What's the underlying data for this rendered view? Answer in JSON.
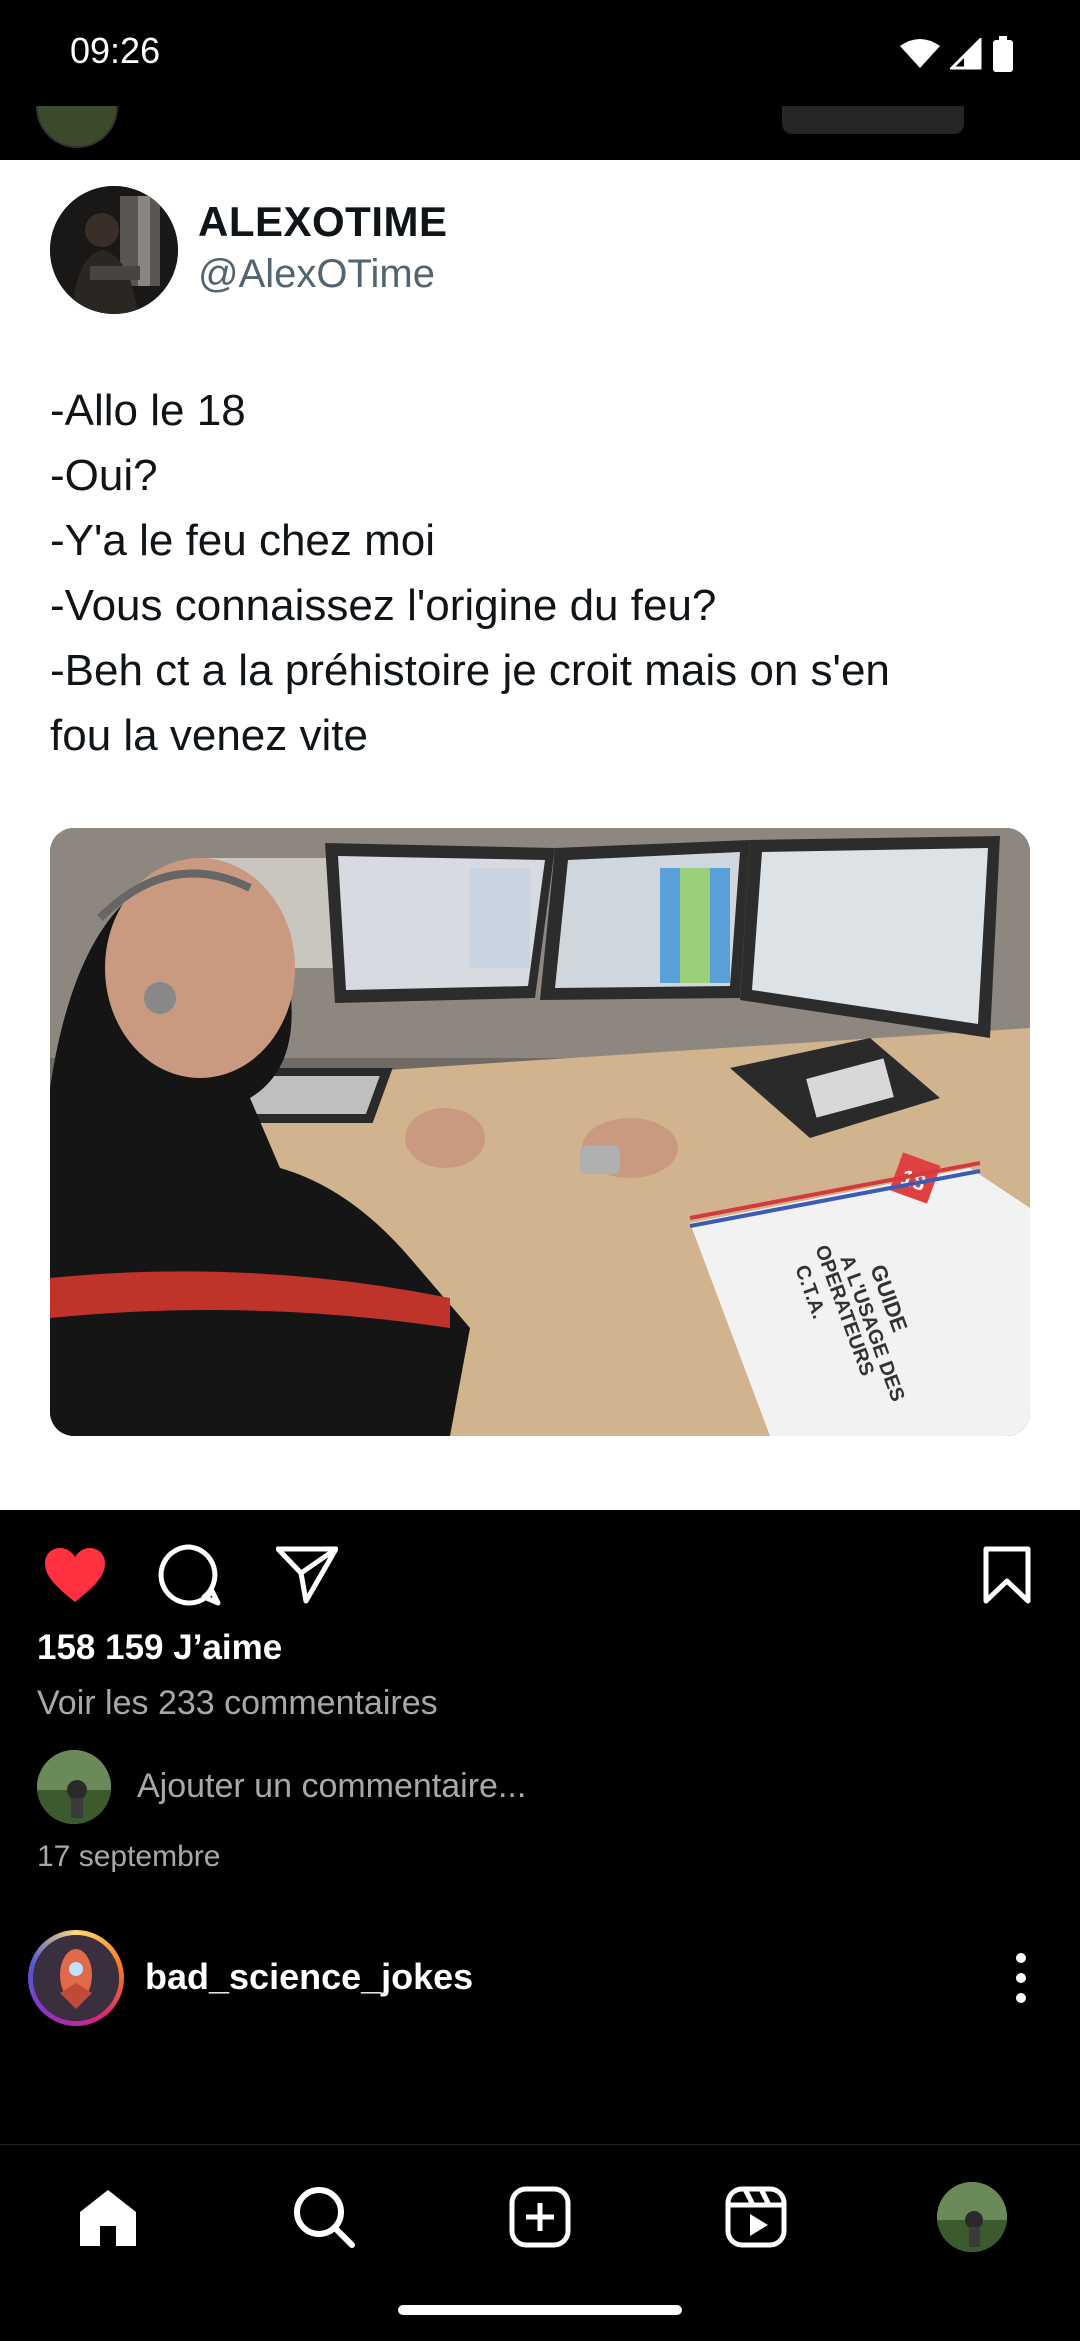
{
  "status_bar": {
    "time": "09:26"
  },
  "tweet": {
    "display_name": "ALEXOTIME",
    "handle": "@AlexOTime",
    "lines": [
      "-Allo le 18",
      "-Oui?",
      "-Y'a le feu chez moi",
      "-Vous connaissez l'origine du feu?",
      "-Beh ct a la préhistoire je croit mais on s'en",
      "fou la venez vite"
    ],
    "photo_binder_text": [
      "GUIDE",
      "A L'USAGE DES",
      "OPERATEURS",
      "C.T.A."
    ],
    "photo_binder_badge": "18"
  },
  "post": {
    "likes_text": "158 159 J’aime",
    "comments_text": "Voir les 233 commentaires",
    "add_comment_placeholder": "Ajouter un commentaire...",
    "date": "17 septembre",
    "liked": true,
    "like_color": "#ff3040"
  },
  "next_post": {
    "username": "bad_science_jokes"
  },
  "icons": {
    "like": "heart-icon",
    "comment": "comment-bubble-icon",
    "share": "paper-plane-icon",
    "save": "bookmark-icon",
    "more": "more-vertical-icon",
    "nav": [
      "home-icon",
      "search-icon",
      "create-icon",
      "reels-icon",
      "profile-avatar"
    ]
  }
}
